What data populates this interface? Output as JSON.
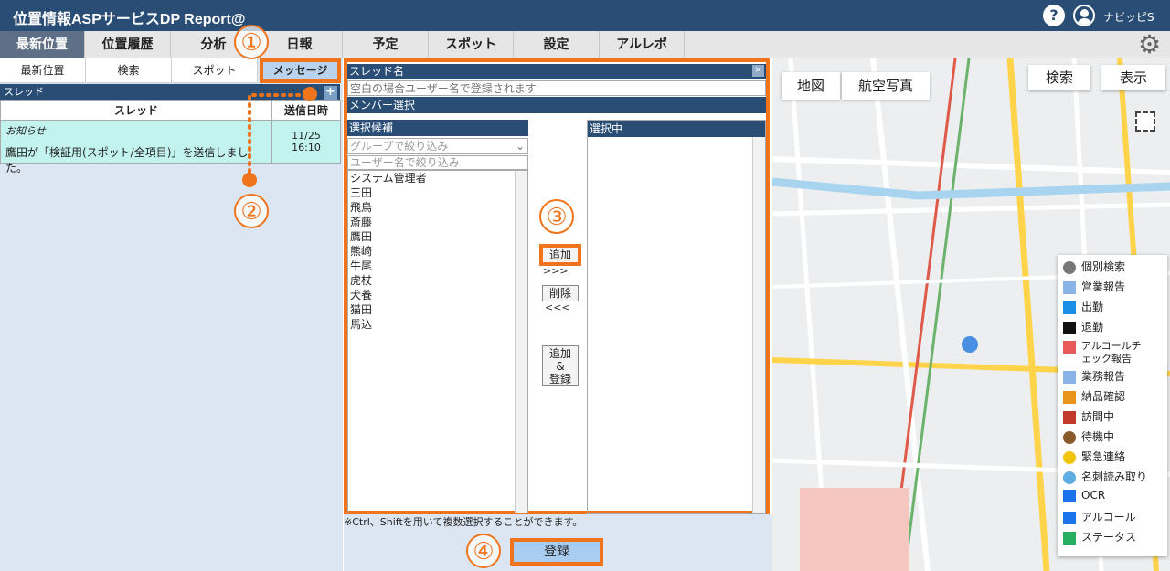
{
  "app": {
    "title": "位置情報ASPサービスDP Report@",
    "help_label": "?",
    "user_name": "ナビッピS"
  },
  "nav": {
    "tabs": [
      "最新位置",
      "位置履歴",
      "分析",
      "日報",
      "予定",
      "スポット",
      "設定",
      "アルレポ"
    ],
    "active": "最新位置"
  },
  "subnav": {
    "tabs": [
      "最新位置",
      "検索",
      "スポット",
      "メッセージ"
    ],
    "active": "メッセージ"
  },
  "thread_panel": {
    "header": "スレッド",
    "add_label": "+",
    "columns": [
      "スレッド",
      "送信日時"
    ],
    "rows": [
      {
        "title": "お知らせ",
        "body": "鷹田が「検証用(スポット/全項目)」を送信しました。",
        "date": "11/25",
        "time": "16:10"
      }
    ]
  },
  "dialog": {
    "title": "スレッド名",
    "close_label": "×",
    "name_placeholder": "空白の場合ユーザー名で登録されます",
    "member_header": "メンバー選択",
    "candidates_header": "選択候補",
    "group_placeholder": "グループで絞り込み",
    "user_filter_placeholder": "ユーザー名で絞り込み",
    "candidates": [
      "システム管理者",
      "三田",
      "飛鳥",
      "斎藤",
      "鷹田",
      "熊崎",
      "牛尾",
      "虎杖",
      "犬養",
      "猫田",
      "馬込"
    ],
    "selected_header": "選択中",
    "add_button": "追加",
    "add_arrows": ">>>",
    "remove_button": "削除",
    "remove_arrows": "<<<",
    "add_register_button": "追加\n&\n登録"
  },
  "note": "※Ctrl、Shiftを用いて複数選択することができます。",
  "register_button": "登録",
  "map": {
    "map_tab": "地図",
    "aerial_tab": "航空写真",
    "search_button": "検索",
    "display_button": "表示"
  },
  "legend": [
    "個別検索",
    "営業報告",
    "出勤",
    "退勤",
    "アルコールチェック報告",
    "業務報告",
    "納品確認",
    "訪問中",
    "待機中",
    "緊急連絡",
    "名刺読み取り",
    "OCR",
    "アルコール",
    "ステータス"
  ],
  "callouts": [
    "①",
    "②",
    "③",
    "④"
  ],
  "colors": {
    "header": "#2a4d75",
    "accent": "#f0741c",
    "highlight_row": "#c3f3ee"
  }
}
